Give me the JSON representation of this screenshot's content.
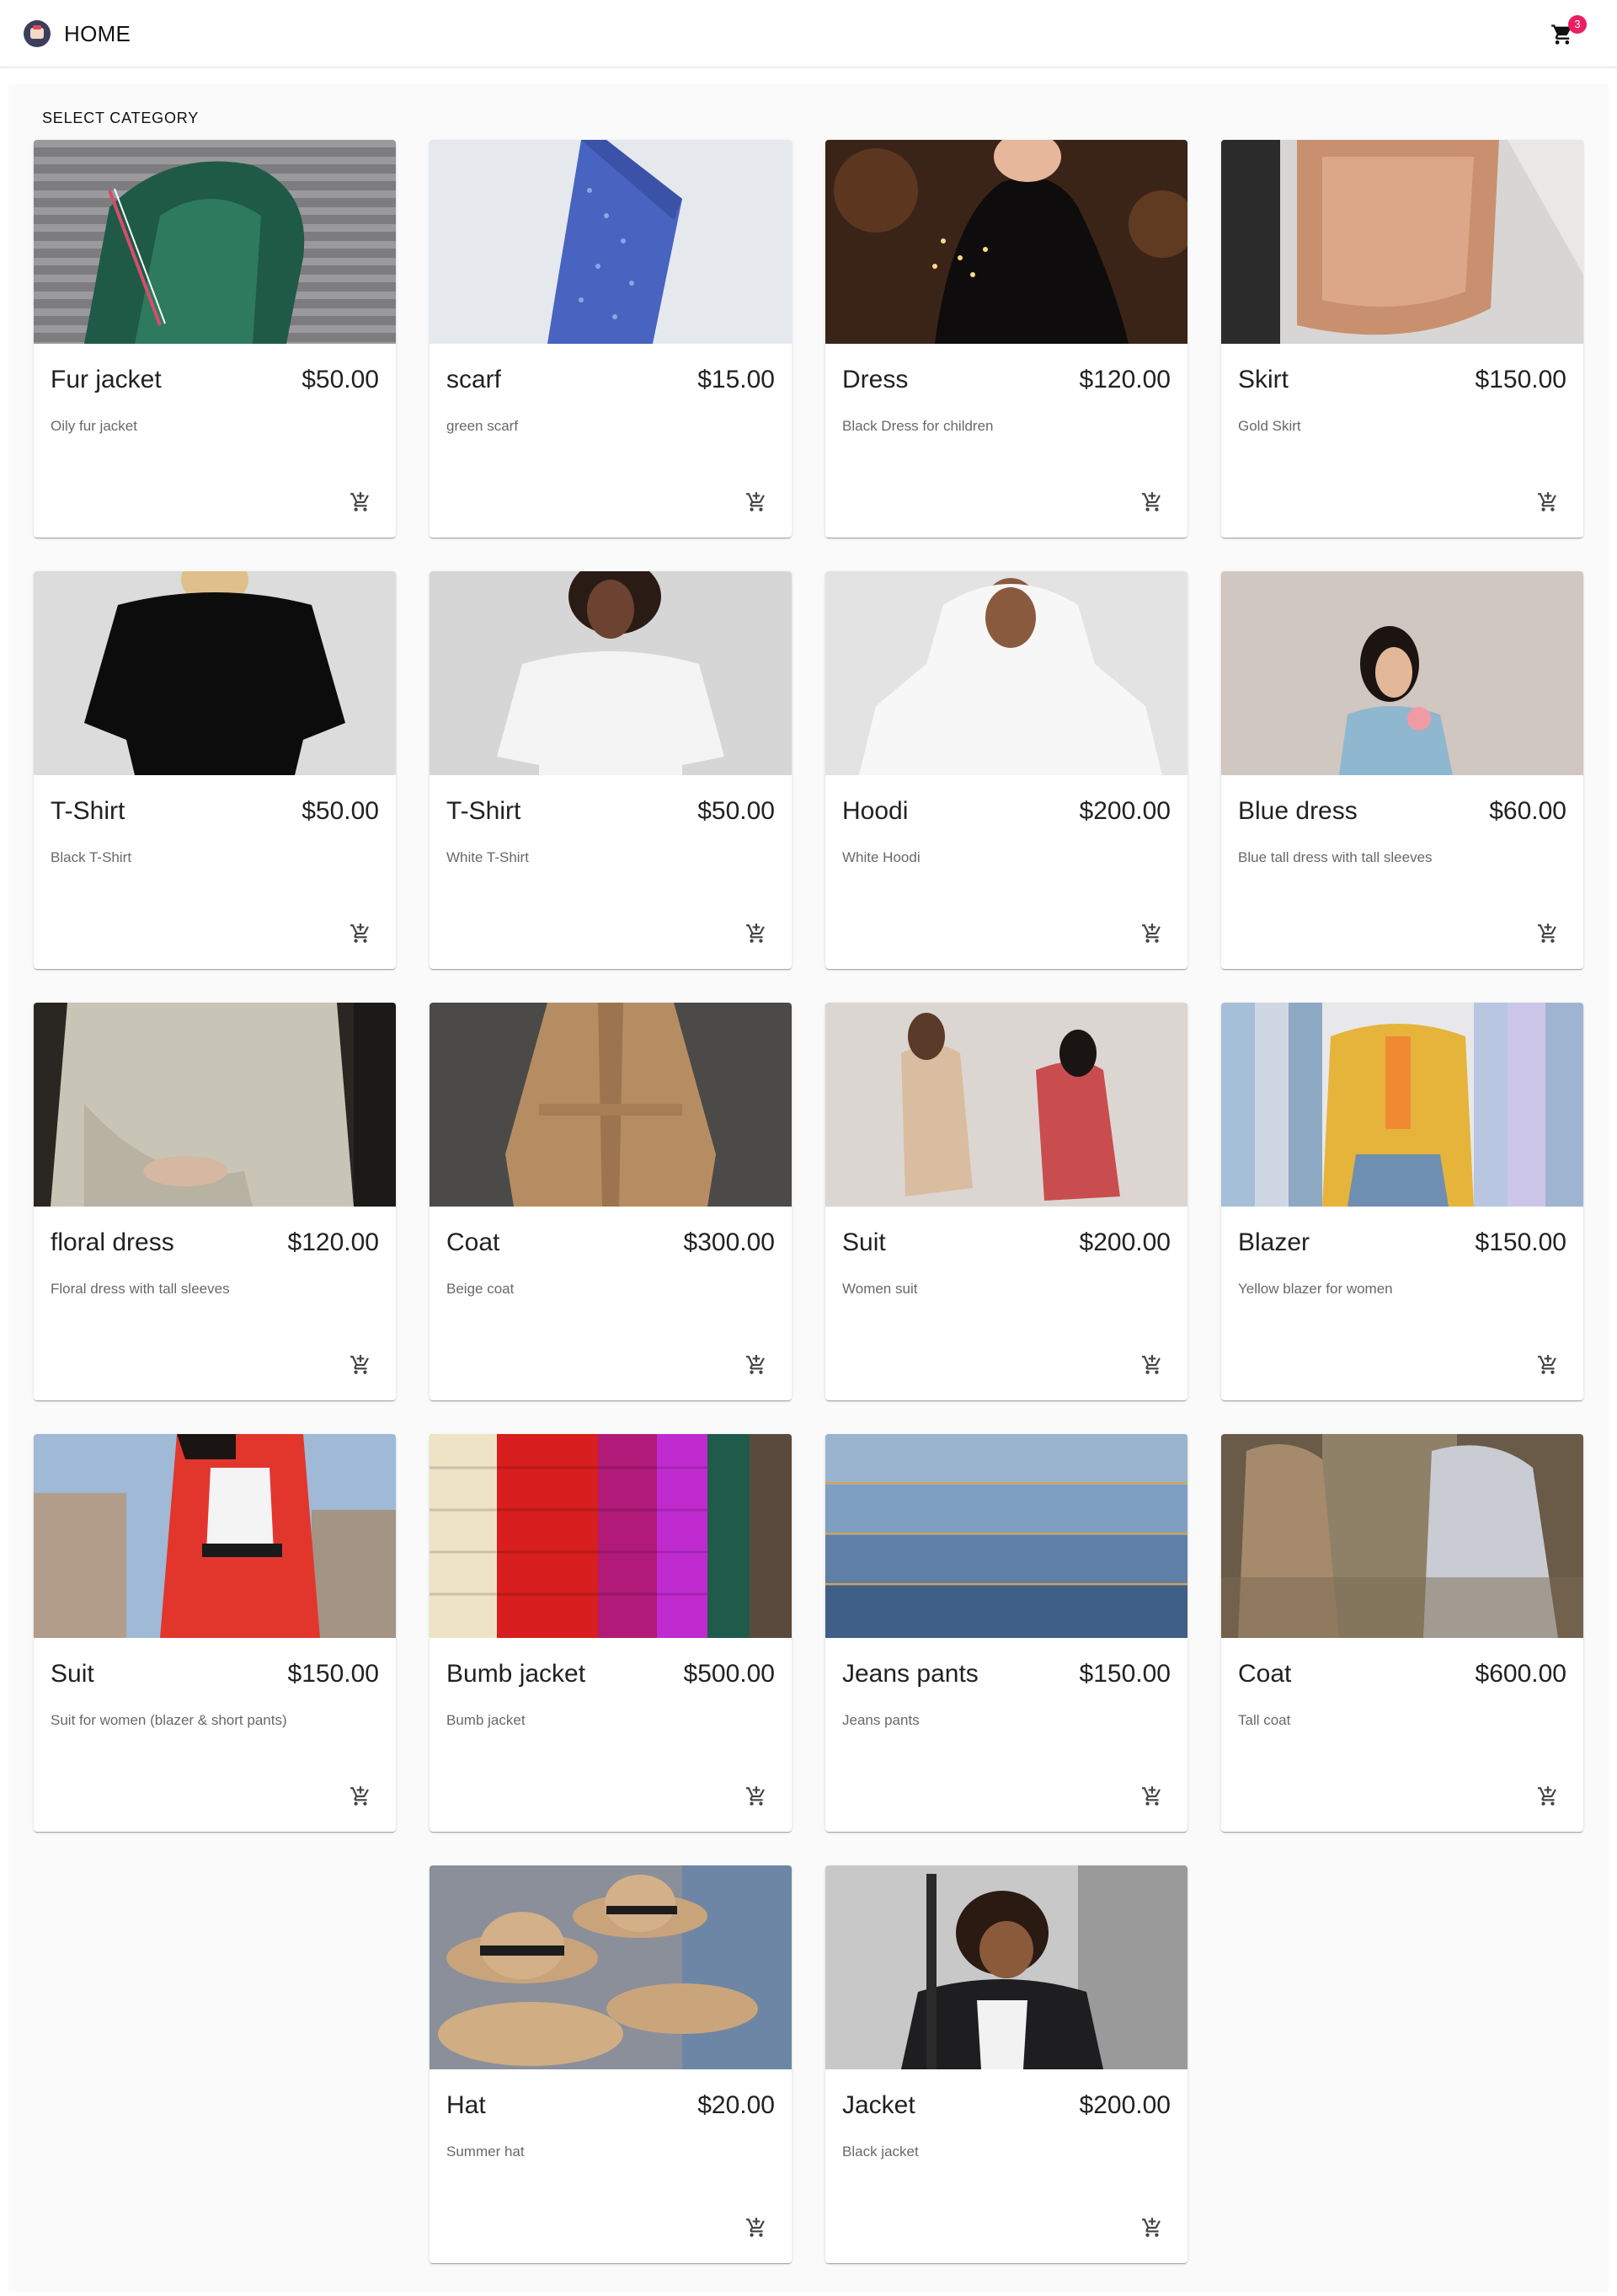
{
  "header": {
    "home_label": "HOME",
    "cart_count": "3",
    "logo_icon": "shop-logo-icon",
    "cart_icon": "shopping-cart-icon",
    "badge_color": "#e91e63"
  },
  "main": {
    "section_title": "SELECT CATEGORY",
    "products": [
      {
        "name": "Fur jacket",
        "price": "$50.00",
        "description": "Oily fur jacket"
      },
      {
        "name": "scarf",
        "price": "$15.00",
        "description": "green scarf"
      },
      {
        "name": "Dress",
        "price": "$120.00",
        "description": "Black Dress for children"
      },
      {
        "name": "Skirt",
        "price": "$150.00",
        "description": "Gold Skirt"
      },
      {
        "name": "T-Shirt",
        "price": "$50.00",
        "description": "Black T-Shirt"
      },
      {
        "name": "T-Shirt",
        "price": "$50.00",
        "description": "White T-Shirt"
      },
      {
        "name": "Hoodi",
        "price": "$200.00",
        "description": "White Hoodi"
      },
      {
        "name": "Blue dress",
        "price": "$60.00",
        "description": "Blue tall dress with tall sleeves"
      },
      {
        "name": "floral dress",
        "price": "$120.00",
        "description": "Floral dress with tall sleeves"
      },
      {
        "name": "Coat",
        "price": "$300.00",
        "description": "Beige coat"
      },
      {
        "name": "Suit",
        "price": "$200.00",
        "description": "Women suit"
      },
      {
        "name": "Blazer",
        "price": "$150.00",
        "description": "Yellow blazer for women"
      },
      {
        "name": "Suit",
        "price": "$150.00",
        "description": "Suit for women (blazer & short pants)"
      },
      {
        "name": "Bumb jacket",
        "price": "$500.00",
        "description": "Bumb jacket"
      },
      {
        "name": "Jeans pants",
        "price": "$150.00",
        "description": "Jeans pants"
      },
      {
        "name": "Coat",
        "price": "$600.00",
        "description": "Tall coat"
      },
      {
        "name": "Hat",
        "price": "$20.00",
        "description": "Summer hat"
      },
      {
        "name": "Jacket",
        "price": "$200.00",
        "description": "Black jacket"
      }
    ],
    "add_to_cart_icon": "add-shopping-cart-icon"
  }
}
